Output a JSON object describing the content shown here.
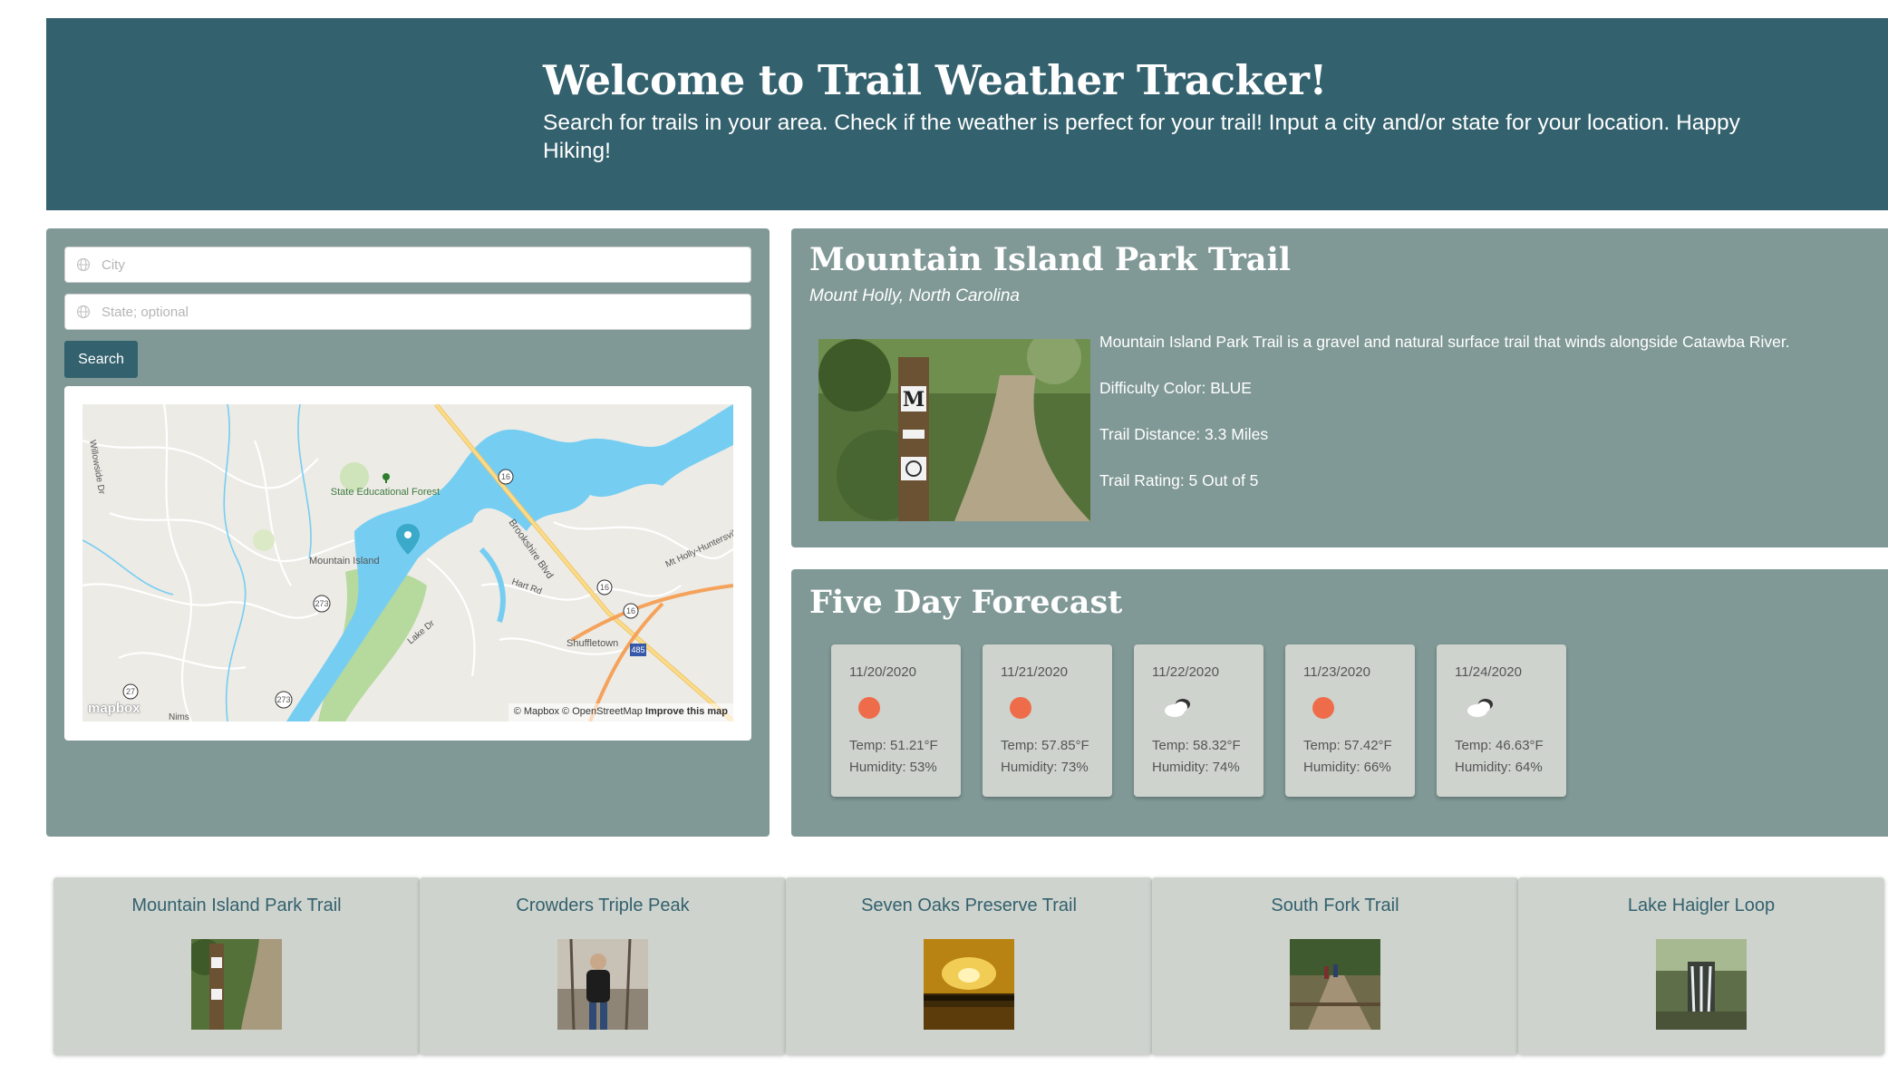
{
  "header": {
    "title": "Welcome to Trail Weather Tracker!",
    "subtitle": "Search for trails in your area. Check if the weather is perfect for your trail! Input a city and/or state for your location. Happy Hiking!"
  },
  "search": {
    "city_placeholder": "City",
    "state_placeholder": "State; optional",
    "button_label": "Search"
  },
  "map": {
    "labels": {
      "forest": "State Educational Forest",
      "mountain_island": "Mountain Island",
      "brookshire": "Brookshire Blvd",
      "mt_holly": "Mt Holly-Huntersville",
      "hart_rd": "Hart Rd",
      "lake_dr": "Lake Dr",
      "shuffletown": "Shuffletown",
      "willowside": "Willowside Dr",
      "nims": "Nims",
      "route_16": "16",
      "route_273": "273",
      "route_27": "27",
      "route_485": "485"
    },
    "logo": "mapbox",
    "attribution": "© Mapbox © OpenStreetMap",
    "improve_link": "Improve this map"
  },
  "trail": {
    "name": "Mountain Island Park Trail",
    "location": "Mount Holly, North Carolina",
    "description": "Mountain Island Park Trail is a gravel and natural surface trail that winds alongside Catawba River.",
    "difficulty": "Difficulty Color: BLUE",
    "distance": "Trail Distance: 3.3 Miles",
    "rating": "Trail Rating: 5 Out of 5"
  },
  "forecast": {
    "title": "Five Day Forecast",
    "days": [
      {
        "date": "11/20/2020",
        "icon": "sun-icon",
        "temp": "Temp: 51.21°F",
        "humidity": "Humidity: 53%"
      },
      {
        "date": "11/21/2020",
        "icon": "sun-icon",
        "temp": "Temp: 57.85°F",
        "humidity": "Humidity: 73%"
      },
      {
        "date": "11/22/2020",
        "icon": "cloud-icon",
        "temp": "Temp: 58.32°F",
        "humidity": "Humidity: 74%"
      },
      {
        "date": "11/23/2020",
        "icon": "sun-icon",
        "temp": "Temp: 57.42°F",
        "humidity": "Humidity: 66%"
      },
      {
        "date": "11/24/2020",
        "icon": "cloud-icon",
        "temp": "Temp: 46.63°F",
        "humidity": "Humidity: 64%"
      }
    ]
  },
  "trail_cards": [
    {
      "name": "Mountain Island Park Trail"
    },
    {
      "name": "Crowders Triple Peak"
    },
    {
      "name": "Seven Oaks Preserve Trail"
    },
    {
      "name": "South Fork Trail"
    },
    {
      "name": "Lake Haigler Loop"
    }
  ],
  "colors": {
    "header_bg": "#33616d",
    "panel_bg": "#809996",
    "card_bg": "#ced3ce",
    "sun": "#ef6c4a",
    "water": "#76cdf2"
  }
}
